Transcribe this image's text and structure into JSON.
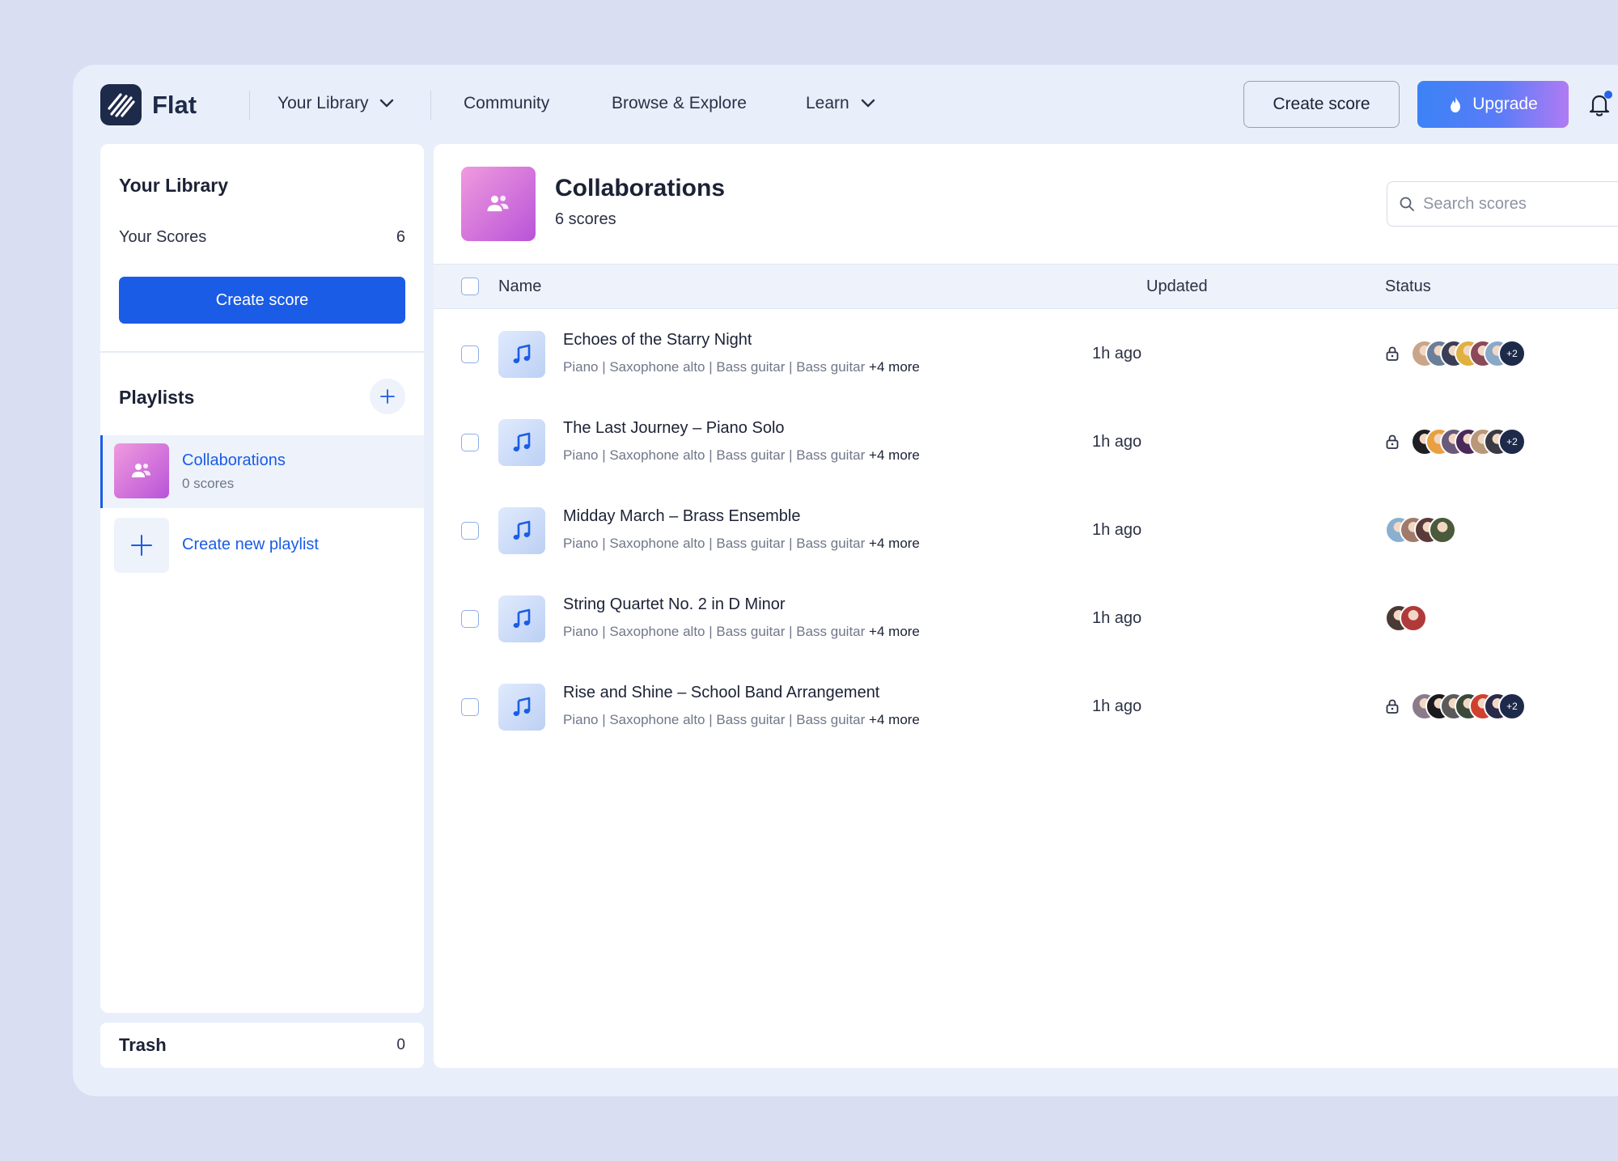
{
  "brand": {
    "name": "Flat"
  },
  "nav": {
    "library": "Your Library",
    "community": "Community",
    "browse": "Browse & Explore",
    "learn": "Learn",
    "create_score": "Create score",
    "upgrade": "Upgrade"
  },
  "sidebar": {
    "title": "Your Library",
    "scores_label": "Your Scores",
    "scores_count": "6",
    "create_score": "Create score",
    "playlists_title": "Playlists",
    "active_playlist": {
      "name": "Collaborations",
      "count": "0 scores"
    },
    "create_playlist": "Create new playlist",
    "trash_label": "Trash",
    "trash_count": "0"
  },
  "main": {
    "title": "Collaborations",
    "subtitle": "6 scores",
    "search_placeholder": "Search scores",
    "columns": {
      "name": "Name",
      "updated": "Updated",
      "status": "Status"
    },
    "rows": [
      {
        "title": "Echoes of the Starry Night",
        "instruments": "Piano | Saxophone alto | Bass guitar | Bass guitar",
        "more": "+4 more",
        "updated": "1h ago",
        "locked": true,
        "avatar_colors": [
          "#c9a58a",
          "#6b7f9a",
          "#3b3f55",
          "#e0b040",
          "#8a4a5a",
          "#8aa8c8"
        ],
        "extra": "+2"
      },
      {
        "title": "The Last Journey – Piano Solo",
        "instruments": "Piano | Saxophone alto | Bass guitar | Bass guitar",
        "more": "+4 more",
        "updated": "1h ago",
        "locked": true,
        "avatar_colors": [
          "#1f1f24",
          "#e8a040",
          "#6a5a7a",
          "#4a2a5a",
          "#b89878",
          "#3a3a44"
        ],
        "extra": "+2"
      },
      {
        "title": "Midday March – Brass Ensemble",
        "instruments": "Piano | Saxophone alto | Bass guitar | Bass guitar",
        "more": "+4 more",
        "updated": "1h ago",
        "locked": false,
        "avatar_colors": [
          "#8ab0d0",
          "#a07a6a",
          "#5a3a3a",
          "#4a5a3a"
        ],
        "extra": ""
      },
      {
        "title": "String Quartet No. 2 in D Minor",
        "instruments": "Piano | Saxophone alto | Bass guitar | Bass guitar",
        "more": "+4 more",
        "updated": "1h ago",
        "locked": false,
        "avatar_colors": [
          "#4a3a34",
          "#b03a3a"
        ],
        "extra": ""
      },
      {
        "title": "Rise and Shine – School Band Arrangement",
        "instruments": "Piano | Saxophone alto | Bass guitar | Bass guitar",
        "more": "+4 more",
        "updated": "1h ago",
        "locked": true,
        "avatar_colors": [
          "#8a7a8a",
          "#1a1a1e",
          "#5a5a5a",
          "#3a4a3a",
          "#d04030",
          "#2a2a4a"
        ],
        "extra": "+2"
      }
    ]
  },
  "colors": {
    "accent": "#1a5ce6",
    "playlist_gradient": [
      "#f19ade",
      "#b854d8"
    ],
    "navy": "#1e2a4a"
  }
}
